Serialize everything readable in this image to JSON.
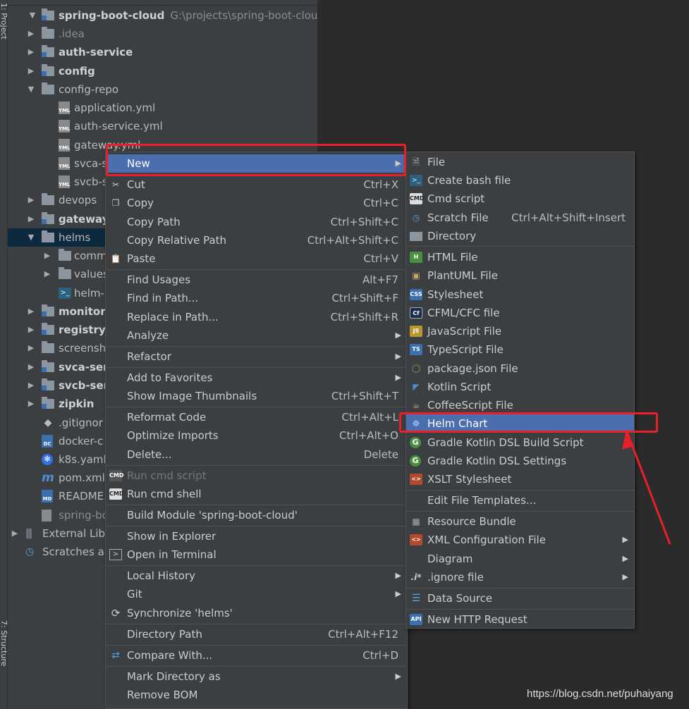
{
  "sidebar": {
    "project_tab": "1: Project",
    "structure_tab": "7: Structure"
  },
  "tree": [
    {
      "label": "spring-boot-cloud",
      "path": "G:\\projects\\spring-boot-cloud",
      "bold": true
    },
    {
      "label": ".idea"
    },
    {
      "label": "auth-service",
      "bold": true
    },
    {
      "label": "config",
      "bold": true
    },
    {
      "label": "config-repo"
    },
    {
      "label": "application.yml"
    },
    {
      "label": "auth-service.yml"
    },
    {
      "label": "gateway.yml"
    },
    {
      "label": "svca-s"
    },
    {
      "label": "svcb-s"
    },
    {
      "label": "devops"
    },
    {
      "label": "gateway",
      "bold": true
    },
    {
      "label": "helms"
    },
    {
      "label": "comm"
    },
    {
      "label": "values"
    },
    {
      "label": "helm-i"
    },
    {
      "label": "monitor",
      "bold": true
    },
    {
      "label": "registry",
      "bold": true
    },
    {
      "label": "screensh"
    },
    {
      "label": "svca-serv",
      "bold": true
    },
    {
      "label": "svcb-serv",
      "bold": true
    },
    {
      "label": "zipkin",
      "bold": true
    },
    {
      "label": ".gitignor"
    },
    {
      "label": "docker-c"
    },
    {
      "label": "k8s.yaml"
    },
    {
      "label": "pom.xml"
    },
    {
      "label": "README."
    },
    {
      "label": "spring-bo"
    },
    {
      "label": "External Libr"
    },
    {
      "label": "Scratches an"
    }
  ],
  "context_menu": [
    {
      "label": "New",
      "shortcut": "",
      "submenu": true,
      "highlight": true
    },
    {
      "label": "Cut",
      "shortcut": "Ctrl+X",
      "icon": "scissors"
    },
    {
      "label": "Copy",
      "shortcut": "Ctrl+C",
      "icon": "copy"
    },
    {
      "label": "Copy Path",
      "shortcut": "Ctrl+Shift+C"
    },
    {
      "label": "Copy Relative Path",
      "shortcut": "Ctrl+Alt+Shift+C"
    },
    {
      "label": "Paste",
      "shortcut": "Ctrl+V",
      "icon": "paste"
    },
    {
      "label": "Find Usages",
      "shortcut": "Alt+F7"
    },
    {
      "label": "Find in Path...",
      "shortcut": "Ctrl+Shift+F"
    },
    {
      "label": "Replace in Path...",
      "shortcut": "Ctrl+Shift+R"
    },
    {
      "label": "Analyze",
      "shortcut": "",
      "submenu": true
    },
    {
      "label": "Refactor",
      "shortcut": "",
      "submenu": true
    },
    {
      "label": "Add to Favorites",
      "shortcut": "",
      "submenu": true
    },
    {
      "label": "Show Image Thumbnails",
      "shortcut": "Ctrl+Shift+T"
    },
    {
      "label": "Reformat Code",
      "shortcut": "Ctrl+Alt+L"
    },
    {
      "label": "Optimize Imports",
      "shortcut": "Ctrl+Alt+O"
    },
    {
      "label": "Delete...",
      "shortcut": "Delete"
    },
    {
      "label": "Run cmd script",
      "shortcut": "",
      "disabled": true
    },
    {
      "label": "Run cmd shell",
      "shortcut": "",
      "icon": "cmd"
    },
    {
      "label": "Build Module 'spring-boot-cloud'",
      "shortcut": ""
    },
    {
      "label": "Show in Explorer",
      "shortcut": ""
    },
    {
      "label": "Open in Terminal",
      "shortcut": "",
      "icon": "terminal"
    },
    {
      "label": "Local History",
      "shortcut": "",
      "submenu": true
    },
    {
      "label": "Git",
      "shortcut": "",
      "submenu": true
    },
    {
      "label": "Synchronize 'helms'",
      "shortcut": "",
      "icon": "sync"
    },
    {
      "label": "Directory Path",
      "shortcut": "Ctrl+Alt+F12"
    },
    {
      "label": "Compare With...",
      "shortcut": "Ctrl+D",
      "icon": "compare"
    },
    {
      "label": "Mark Directory as",
      "shortcut": "",
      "submenu": true
    },
    {
      "label": "Remove BOM",
      "shortcut": ""
    }
  ],
  "new_submenu": [
    {
      "label": "File",
      "shortcut": ""
    },
    {
      "label": "Create bash file",
      "shortcut": ""
    },
    {
      "label": "Cmd script",
      "shortcut": ""
    },
    {
      "label": "Scratch File",
      "shortcut": "Ctrl+Alt+Shift+Insert"
    },
    {
      "label": "Directory",
      "shortcut": ""
    },
    {
      "label": "HTML File",
      "shortcut": ""
    },
    {
      "label": "PlantUML File",
      "shortcut": ""
    },
    {
      "label": "Stylesheet",
      "shortcut": ""
    },
    {
      "label": "CFML/CFC file",
      "shortcut": ""
    },
    {
      "label": "JavaScript File",
      "shortcut": ""
    },
    {
      "label": "TypeScript File",
      "shortcut": ""
    },
    {
      "label": "package.json File",
      "shortcut": ""
    },
    {
      "label": "Kotlin Script",
      "shortcut": ""
    },
    {
      "label": "CoffeeScript File",
      "shortcut": ""
    },
    {
      "label": "Helm Chart",
      "shortcut": "",
      "highlight": true
    },
    {
      "label": "Gradle Kotlin DSL Build Script",
      "shortcut": ""
    },
    {
      "label": "Gradle Kotlin DSL Settings",
      "shortcut": ""
    },
    {
      "label": "XSLT Stylesheet",
      "shortcut": ""
    },
    {
      "label": "Edit File Templates...",
      "shortcut": ""
    },
    {
      "label": "Resource Bundle",
      "shortcut": ""
    },
    {
      "label": "XML Configuration File",
      "shortcut": "",
      "submenu": true
    },
    {
      "label": "Diagram",
      "shortcut": "",
      "submenu": true
    },
    {
      "label": ".ignore file",
      "shortcut": "",
      "submenu": true
    },
    {
      "label": "Data Source",
      "shortcut": ""
    },
    {
      "label": "New HTTP Request",
      "shortcut": ""
    }
  ],
  "icon_text": {
    "cmd": "CMD",
    "html": "H",
    "css": "CSS",
    "cf": "Cf",
    "js": "JS",
    "ts": "TS",
    "yml": "YML",
    "md": "MD",
    "dc": "DC",
    "ignore": ".i*",
    "api": "API",
    "maven": "m"
  },
  "colors": {
    "highlight": "#4b6eaf",
    "annotation": "#e8202a",
    "background": "#3c3f41"
  },
  "watermark": "https://blog.csdn.net/puhaiyang"
}
